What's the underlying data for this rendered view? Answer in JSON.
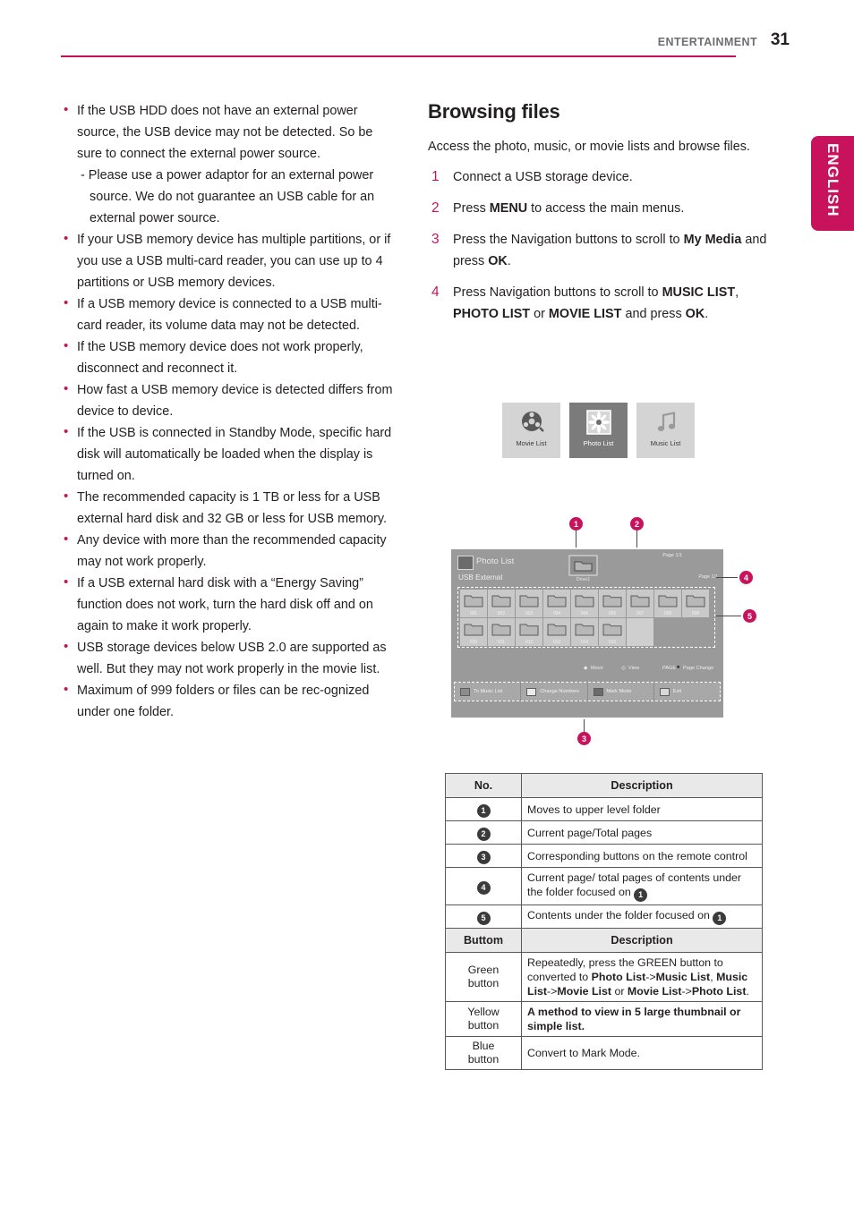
{
  "header": {
    "section": "ENTERTAINMENT",
    "page_number": "31",
    "language_tab": "ENGLISH"
  },
  "left_column": {
    "bullets": [
      {
        "text": "If the USB HDD does not have an external power source, the USB device may not be detected. So be sure to connect the external power source.",
        "sub": "- Please use a power adaptor for an external power source. We do not guarantee an USB cable for an external power source."
      },
      {
        "text": "If your USB memory device has multiple partitions, or if you use a USB multi-card reader, you can use up to 4 partitions or USB memory devices."
      },
      {
        "text": "If a USB memory device is connected to a USB multi-card reader, its volume data may not be detected."
      },
      {
        "text": "If the USB memory device does not work properly, disconnect and reconnect it."
      },
      {
        "text": "How fast a USB memory device is detected differs from device to device."
      },
      {
        "text": "If the USB is connected in Standby Mode, specific hard disk will automatically be loaded when the display is turned on."
      },
      {
        "text": "The recommended capacity is 1 TB or less for a USB external hard disk and 32 GB or less for USB memory."
      },
      {
        "text": "Any device with more than the recommended capacity may not work properly."
      },
      {
        "text": "If a USB external hard disk with a “Energy Saving” function does not work, turn the hard disk off and on again to make it work properly."
      },
      {
        "text": "USB storage devices below USB 2.0 are supported as well. But they may not work properly in the movie list."
      },
      {
        "text": "Maximum of 999 folders or files can be rec-ognized under one folder."
      }
    ]
  },
  "right_column": {
    "title": "Browsing files",
    "intro": "Access the photo, music, or movie lists and browse files.",
    "steps": [
      {
        "num": "1",
        "html": "Connect a USB storage device."
      },
      {
        "num": "2",
        "html": "Press <b>MENU</b> to access the main menus."
      },
      {
        "num": "3",
        "html": "Press the Navigation buttons to scroll to <b>My Media</b> and press <b>OK</b>."
      },
      {
        "num": "4",
        "html": "Press Navigation buttons to scroll to <b>MUSIC LIST</b>, <b>PHOTO LIST</b> or <b>MOVIE LIST</b> and press <b>OK</b>."
      }
    ],
    "tiles": [
      {
        "label": "Movie List",
        "icon": "film-reel-icon",
        "selected": false
      },
      {
        "label": "Photo List",
        "icon": "photo-flower-icon",
        "selected": true
      },
      {
        "label": "Music List",
        "icon": "music-note-icon",
        "selected": false
      }
    ]
  },
  "tv_screen": {
    "title": "Photo List",
    "source": "USB External",
    "drive_label": "Drive1",
    "page_top": "Page 1/1",
    "page_right": "Page 1/1",
    "grid_row1": [
      "001",
      "002",
      "003",
      "004",
      "005",
      "006",
      "007",
      "008",
      "009"
    ],
    "grid_row2": [
      "010",
      "011",
      "012",
      "013",
      "014",
      "015"
    ],
    "hints": [
      {
        "icon": "dpad-icon",
        "label": "Move"
      },
      {
        "icon": "ok-icon",
        "label": "View"
      },
      {
        "icon": "page-icon",
        "label": "PAGE",
        "label2": "Page Change"
      }
    ],
    "keys": [
      {
        "color": "#8c8c8c",
        "label": "To Music List"
      },
      {
        "color": "#eaeaea",
        "label": "Change Numbers"
      },
      {
        "color": "#6b6b6b",
        "label": "Mark Mode"
      },
      {
        "color": "#d8d8d8",
        "label": "Exit"
      }
    ],
    "callouts": [
      "1",
      "2",
      "3",
      "4",
      "5"
    ]
  },
  "tables": {
    "no_table": {
      "headers": [
        "No.",
        "Description"
      ],
      "rows": [
        {
          "no": "1",
          "desc": "Moves to upper level folder"
        },
        {
          "no": "2",
          "desc": "Current page/Total pages"
        },
        {
          "no": "3",
          "desc": "Corresponding buttons on the remote control"
        },
        {
          "no": "4",
          "desc": "Current page/ total pages of contents under the folder focused on",
          "ref": "1"
        },
        {
          "no": "5",
          "desc": "Contents under the folder focused on",
          "ref": "1"
        }
      ]
    },
    "button_table": {
      "headers": [
        "Buttom",
        "Description"
      ],
      "rows": [
        {
          "button": "Green button",
          "desc_html": "Repeatedly, press the GREEN button to converted to <b>Photo List</b>-&gt;<b>Music List</b>, <b>Music List</b>-&gt;<b>Movie List</b> or <b>Movie List</b>-&gt;<b>Photo List</b>."
        },
        {
          "button": "Yellow button",
          "desc_html": "<b>A method to view in 5 large thumbnail or simple list.</b>"
        },
        {
          "button": "Blue button",
          "desc_html": "Convert to Mark Mode."
        }
      ]
    }
  },
  "colors": {
    "accent": "#c8135c",
    "text": "#231f20",
    "header_gray": "#6d6e71",
    "table_header_bg": "#e9e9e9",
    "badge_dark": "#3b3b3b"
  }
}
